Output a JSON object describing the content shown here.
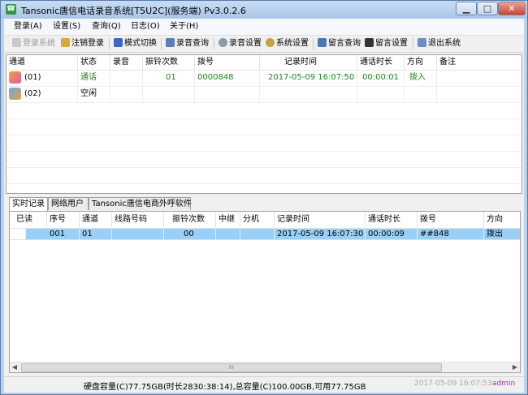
{
  "window": {
    "title": "Tansonic唐信电话录音系统[T5U2C](服务端) Pv3.0.2.6",
    "minimize": "▁",
    "maximize": "□",
    "close": "✕"
  },
  "menu": [
    "登录(A)",
    "设置(S)",
    "查询(Q)",
    "日志(O)",
    "关于(H)"
  ],
  "toolbar": {
    "login": "登录系统",
    "logout": "注销登录",
    "mode": "模式切换",
    "rec_query": "录音查询",
    "rec_settings": "录音设置",
    "sys_settings": "系统设置",
    "msg_query": "留言查询",
    "msg_settings": "留言设置",
    "exit": "退出系统"
  },
  "channels": {
    "headers": [
      "通道",
      "状态",
      "录音",
      "振铃次数",
      "拨号",
      "记录时间",
      "通话时长",
      "方向",
      "备注"
    ],
    "rows": [
      {
        "channel": "(01)",
        "status": "通话",
        "recording": "",
        "rings": "01",
        "dial": "0000848",
        "time": "2017-05-09 16:07:50",
        "duration": "00:00:01",
        "direction": "拨入",
        "note": ""
      },
      {
        "channel": "(02)",
        "status": "空闲",
        "recording": "",
        "rings": "",
        "dial": "",
        "time": "",
        "duration": "",
        "direction": "",
        "note": ""
      }
    ]
  },
  "tabs": [
    "实时记录",
    "网络用户",
    "Tansonic唐信电商外呼软件"
  ],
  "records": {
    "headers": [
      "已读",
      "序号",
      "通道",
      "线路号码",
      "振铃次数",
      "中继",
      "分机",
      "记录时间",
      "通话时长",
      "拨号",
      "方向"
    ],
    "rows": [
      {
        "read": "",
        "seq": "001",
        "channel": "01",
        "line": "",
        "rings": "00",
        "trunk": "",
        "ext": "",
        "time": "2017-05-09 16:07:30",
        "duration": "00:00:09",
        "dial": "##848",
        "direction": "拨出"
      }
    ]
  },
  "scroll": {
    "left": "◀",
    "right": "▶",
    "grip": "III"
  },
  "status": {
    "disk": "硬盘容量(C)77.75GB(时长2830:38:14),总容量(C)100.00GB,可用77.75GB",
    "time": "2017-05-09 16:07:53",
    "user": "admin"
  }
}
